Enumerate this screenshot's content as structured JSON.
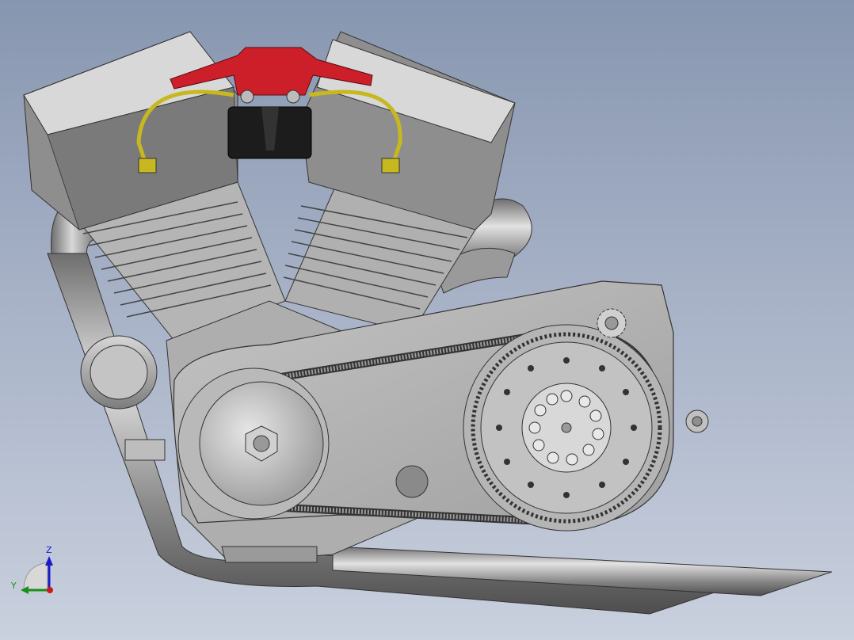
{
  "viewport": {
    "background_top": "#8796b0",
    "background_bottom": "#c9d0de"
  },
  "triad": {
    "z_label": "Z",
    "y_label": "Y",
    "z_color": "#1a1acc",
    "y_color": "#1a8f1a",
    "x_color": "#cc1a1a"
  },
  "model": {
    "body_color": "#b8b8b8",
    "bracket_color": "#cc1f2a",
    "wire_color": "#c8b820",
    "module_color": "#1c1c1c"
  }
}
